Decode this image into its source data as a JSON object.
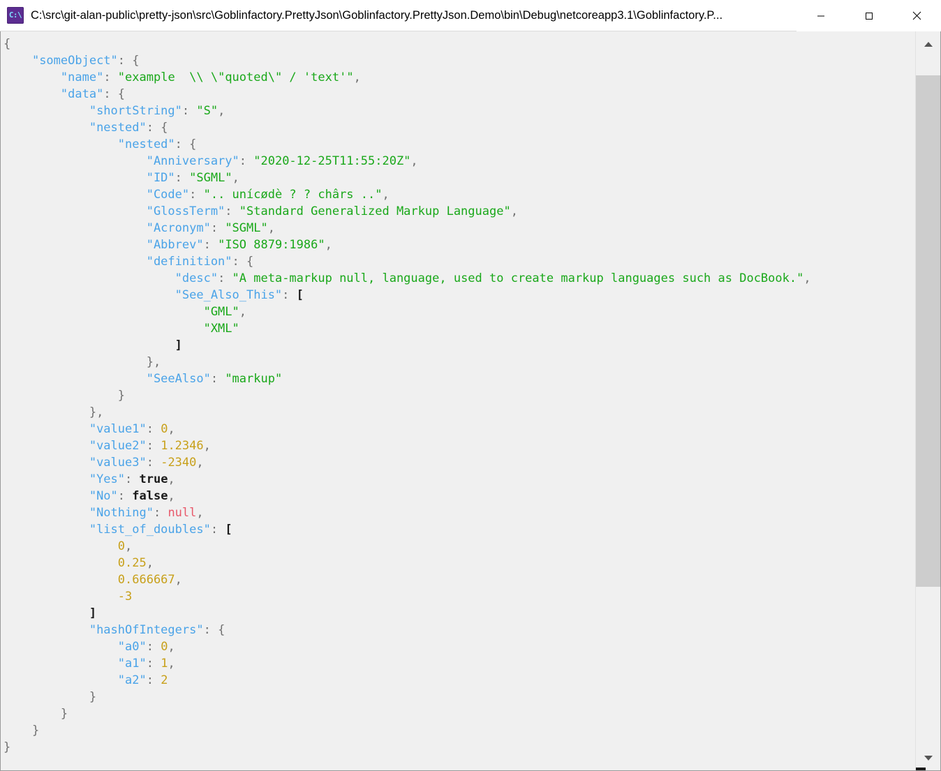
{
  "window": {
    "title": "C:\\src\\git-alan-public\\pretty-json\\src\\Goblinfactory.PrettyJson\\Goblinfactory.PrettyJson.Demo\\bin\\Debug\\netcoreapp3.1\\Goblinfactory.P...",
    "icon_label": "C:\\",
    "minimize_label": "Minimize",
    "maximize_label": "Maximize",
    "close_label": "Close"
  },
  "scrollbar": {
    "up_label": "Scroll up",
    "down_label": "Scroll down",
    "thumb_label": "Vertical scroll thumb"
  },
  "colors": {
    "key": "#4aa3e8",
    "string": "#1aa81a",
    "number": "#c8a01a",
    "boolean": "#1a1a1a",
    "null": "#e8596b",
    "punctuation": "#707070",
    "background": "#f0f0f0",
    "titlebar": "#ffffff",
    "scrollbar_thumb": "#cdcdcd",
    "app_icon": "#5c2d91"
  },
  "console": {
    "lines": [
      {
        "indent": 0,
        "parts": [
          {
            "t": "{",
            "c": "p"
          }
        ]
      },
      {
        "indent": 1,
        "parts": [
          {
            "t": "\"someObject\"",
            "c": "k"
          },
          {
            "t": ": ",
            "c": "p"
          },
          {
            "t": "{",
            "c": "p"
          }
        ]
      },
      {
        "indent": 2,
        "parts": [
          {
            "t": "\"name\"",
            "c": "k"
          },
          {
            "t": ": ",
            "c": "p"
          },
          {
            "t": "\"example  \\\\ \\\"quoted\\\" / 'text'\"",
            "c": "s"
          },
          {
            "t": ",",
            "c": "p"
          }
        ]
      },
      {
        "indent": 2,
        "parts": [
          {
            "t": "\"data\"",
            "c": "k"
          },
          {
            "t": ": ",
            "c": "p"
          },
          {
            "t": "{",
            "c": "p"
          }
        ]
      },
      {
        "indent": 3,
        "parts": [
          {
            "t": "\"shortString\"",
            "c": "k"
          },
          {
            "t": ": ",
            "c": "p"
          },
          {
            "t": "\"S\"",
            "c": "s"
          },
          {
            "t": ",",
            "c": "p"
          }
        ]
      },
      {
        "indent": 3,
        "parts": [
          {
            "t": "\"nested\"",
            "c": "k"
          },
          {
            "t": ": ",
            "c": "p"
          },
          {
            "t": "{",
            "c": "p"
          }
        ]
      },
      {
        "indent": 4,
        "parts": [
          {
            "t": "\"nested\"",
            "c": "k"
          },
          {
            "t": ": ",
            "c": "p"
          },
          {
            "t": "{",
            "c": "p"
          }
        ]
      },
      {
        "indent": 5,
        "parts": [
          {
            "t": "\"Anniversary\"",
            "c": "k"
          },
          {
            "t": ": ",
            "c": "p"
          },
          {
            "t": "\"2020-12-25T11:55:20Z\"",
            "c": "s"
          },
          {
            "t": ",",
            "c": "p"
          }
        ]
      },
      {
        "indent": 5,
        "parts": [
          {
            "t": "\"ID\"",
            "c": "k"
          },
          {
            "t": ": ",
            "c": "p"
          },
          {
            "t": "\"SGML\"",
            "c": "s"
          },
          {
            "t": ",",
            "c": "p"
          }
        ]
      },
      {
        "indent": 5,
        "parts": [
          {
            "t": "\"Code\"",
            "c": "k"
          },
          {
            "t": ": ",
            "c": "p"
          },
          {
            "t": "\".. unícødè ? ? chârs ..\"",
            "c": "s"
          },
          {
            "t": ",",
            "c": "p"
          }
        ]
      },
      {
        "indent": 5,
        "parts": [
          {
            "t": "\"GlossTerm\"",
            "c": "k"
          },
          {
            "t": ": ",
            "c": "p"
          },
          {
            "t": "\"Standard Generalized Markup Language\"",
            "c": "s"
          },
          {
            "t": ",",
            "c": "p"
          }
        ]
      },
      {
        "indent": 5,
        "parts": [
          {
            "t": "\"Acronym\"",
            "c": "k"
          },
          {
            "t": ": ",
            "c": "p"
          },
          {
            "t": "\"SGML\"",
            "c": "s"
          },
          {
            "t": ",",
            "c": "p"
          }
        ]
      },
      {
        "indent": 5,
        "parts": [
          {
            "t": "\"Abbrev\"",
            "c": "k"
          },
          {
            "t": ": ",
            "c": "p"
          },
          {
            "t": "\"ISO 8879:1986\"",
            "c": "s"
          },
          {
            "t": ",",
            "c": "p"
          }
        ]
      },
      {
        "indent": 5,
        "parts": [
          {
            "t": "\"definition\"",
            "c": "k"
          },
          {
            "t": ": ",
            "c": "p"
          },
          {
            "t": "{",
            "c": "p"
          }
        ]
      },
      {
        "indent": 6,
        "parts": [
          {
            "t": "\"desc\"",
            "c": "k"
          },
          {
            "t": ": ",
            "c": "p"
          },
          {
            "t": "\"A meta-markup null, language, used to create markup languages such as DocBook.\"",
            "c": "s"
          },
          {
            "t": ",",
            "c": "p"
          }
        ]
      },
      {
        "indent": 6,
        "parts": [
          {
            "t": "\"See_Also_This\"",
            "c": "k"
          },
          {
            "t": ": ",
            "c": "p"
          },
          {
            "t": "[",
            "c": "br"
          }
        ]
      },
      {
        "indent": 7,
        "parts": [
          {
            "t": "\"GML\"",
            "c": "s"
          },
          {
            "t": ",",
            "c": "p"
          }
        ]
      },
      {
        "indent": 7,
        "parts": [
          {
            "t": "\"XML\"",
            "c": "s"
          }
        ]
      },
      {
        "indent": 6,
        "parts": [
          {
            "t": "]",
            "c": "br"
          }
        ]
      },
      {
        "indent": 5,
        "parts": [
          {
            "t": "}",
            "c": "p"
          },
          {
            "t": ",",
            "c": "p"
          }
        ]
      },
      {
        "indent": 5,
        "parts": [
          {
            "t": "\"SeeAlso\"",
            "c": "k"
          },
          {
            "t": ": ",
            "c": "p"
          },
          {
            "t": "\"markup\"",
            "c": "s"
          }
        ]
      },
      {
        "indent": 4,
        "parts": [
          {
            "t": "}",
            "c": "p"
          }
        ]
      },
      {
        "indent": 3,
        "parts": [
          {
            "t": "}",
            "c": "p"
          },
          {
            "t": ",",
            "c": "p"
          }
        ]
      },
      {
        "indent": 3,
        "parts": [
          {
            "t": "\"value1\"",
            "c": "k"
          },
          {
            "t": ": ",
            "c": "p"
          },
          {
            "t": "0",
            "c": "n"
          },
          {
            "t": ",",
            "c": "p"
          }
        ]
      },
      {
        "indent": 3,
        "parts": [
          {
            "t": "\"value2\"",
            "c": "k"
          },
          {
            "t": ": ",
            "c": "p"
          },
          {
            "t": "1.2346",
            "c": "n"
          },
          {
            "t": ",",
            "c": "p"
          }
        ]
      },
      {
        "indent": 3,
        "parts": [
          {
            "t": "\"value3\"",
            "c": "k"
          },
          {
            "t": ": ",
            "c": "p"
          },
          {
            "t": "-2340",
            "c": "n"
          },
          {
            "t": ",",
            "c": "p"
          }
        ]
      },
      {
        "indent": 3,
        "parts": [
          {
            "t": "\"Yes\"",
            "c": "k"
          },
          {
            "t": ": ",
            "c": "p"
          },
          {
            "t": "true",
            "c": "b"
          },
          {
            "t": ",",
            "c": "p"
          }
        ]
      },
      {
        "indent": 3,
        "parts": [
          {
            "t": "\"No\"",
            "c": "k"
          },
          {
            "t": ": ",
            "c": "p"
          },
          {
            "t": "false",
            "c": "b"
          },
          {
            "t": ",",
            "c": "p"
          }
        ]
      },
      {
        "indent": 3,
        "parts": [
          {
            "t": "\"Nothing\"",
            "c": "k"
          },
          {
            "t": ": ",
            "c": "p"
          },
          {
            "t": "null",
            "c": "nul"
          },
          {
            "t": ",",
            "c": "p"
          }
        ]
      },
      {
        "indent": 3,
        "parts": [
          {
            "t": "\"list_of_doubles\"",
            "c": "k"
          },
          {
            "t": ": ",
            "c": "p"
          },
          {
            "t": "[",
            "c": "br"
          }
        ]
      },
      {
        "indent": 4,
        "parts": [
          {
            "t": "0",
            "c": "n"
          },
          {
            "t": ",",
            "c": "p"
          }
        ]
      },
      {
        "indent": 4,
        "parts": [
          {
            "t": "0.25",
            "c": "n"
          },
          {
            "t": ",",
            "c": "p"
          }
        ]
      },
      {
        "indent": 4,
        "parts": [
          {
            "t": "0.666667",
            "c": "n"
          },
          {
            "t": ",",
            "c": "p"
          }
        ]
      },
      {
        "indent": 4,
        "parts": [
          {
            "t": "-3",
            "c": "n"
          }
        ]
      },
      {
        "indent": 3,
        "parts": [
          {
            "t": "]",
            "c": "br"
          }
        ]
      },
      {
        "indent": 3,
        "parts": [
          {
            "t": "\"hashOfIntegers\"",
            "c": "k"
          },
          {
            "t": ": ",
            "c": "p"
          },
          {
            "t": "{",
            "c": "p"
          }
        ]
      },
      {
        "indent": 4,
        "parts": [
          {
            "t": "\"a0\"",
            "c": "k"
          },
          {
            "t": ": ",
            "c": "p"
          },
          {
            "t": "0",
            "c": "n"
          },
          {
            "t": ",",
            "c": "p"
          }
        ]
      },
      {
        "indent": 4,
        "parts": [
          {
            "t": "\"a1\"",
            "c": "k"
          },
          {
            "t": ": ",
            "c": "p"
          },
          {
            "t": "1",
            "c": "n"
          },
          {
            "t": ",",
            "c": "p"
          }
        ]
      },
      {
        "indent": 4,
        "parts": [
          {
            "t": "\"a2\"",
            "c": "k"
          },
          {
            "t": ": ",
            "c": "p"
          },
          {
            "t": "2",
            "c": "n"
          }
        ]
      },
      {
        "indent": 3,
        "parts": [
          {
            "t": "}",
            "c": "p"
          }
        ]
      },
      {
        "indent": 2,
        "parts": [
          {
            "t": "}",
            "c": "p"
          }
        ]
      },
      {
        "indent": 1,
        "parts": [
          {
            "t": "}",
            "c": "p"
          }
        ]
      },
      {
        "indent": 0,
        "parts": [
          {
            "t": "}",
            "c": "p"
          }
        ]
      }
    ]
  }
}
